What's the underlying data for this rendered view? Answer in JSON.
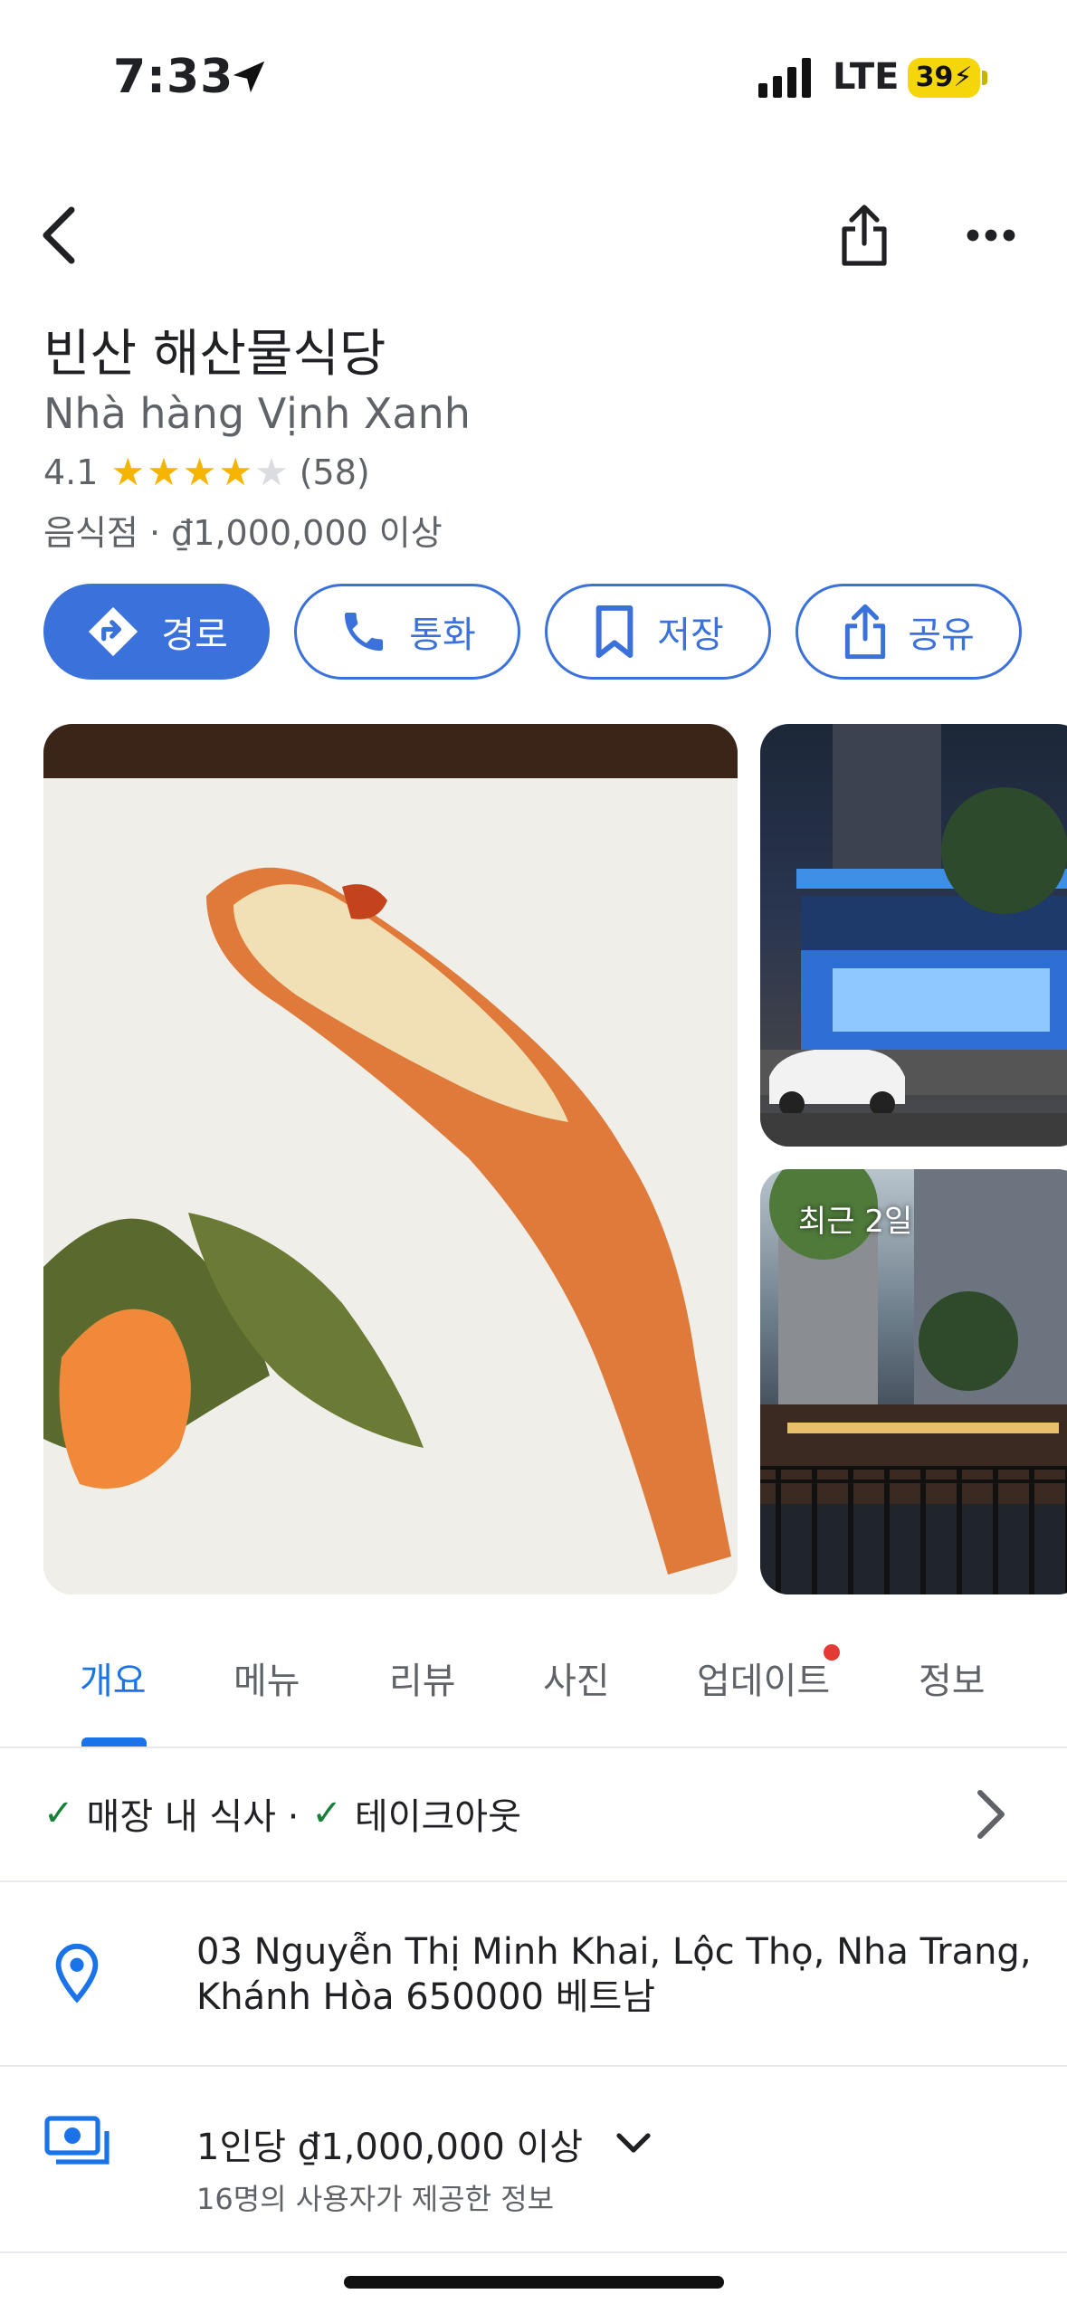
{
  "status_bar": {
    "time": "7:33",
    "network": "LTE",
    "battery": "39"
  },
  "place": {
    "name": "빈산 해산물식당",
    "alt_name": "Nhà hàng Vịnh Xanh",
    "rating": "4.1",
    "rating_stars": 4,
    "review_count": "(58)",
    "category_price": "음식점 · ₫1,000,000 이상"
  },
  "actions": [
    {
      "label": "경로",
      "icon": "directions-icon"
    },
    {
      "label": "통화",
      "icon": "phone-icon"
    },
    {
      "label": "저장",
      "icon": "bookmark-icon"
    },
    {
      "label": "공유",
      "icon": "share-icon"
    }
  ],
  "photos": {
    "badge": "최근 2일"
  },
  "tabs": [
    "개요",
    "메뉴",
    "리뷰",
    "사진",
    "업데이트",
    "정보"
  ],
  "active_tab": "개요",
  "service": {
    "dine_in": "매장 내 식사 ·",
    "takeout": "테이크아웃"
  },
  "address": "03 Nguyễn Thị Minh Khai, Lộc Thọ, Nha Trang, Khánh Hòa 650000 베트남",
  "price": {
    "per_person": "1인당 ₫1,000,000 이상",
    "source": "16명의 사용자가 제공한 정보"
  },
  "colors": {
    "accent": "#3b71db",
    "star": "#f4b400",
    "check": "#188038"
  }
}
